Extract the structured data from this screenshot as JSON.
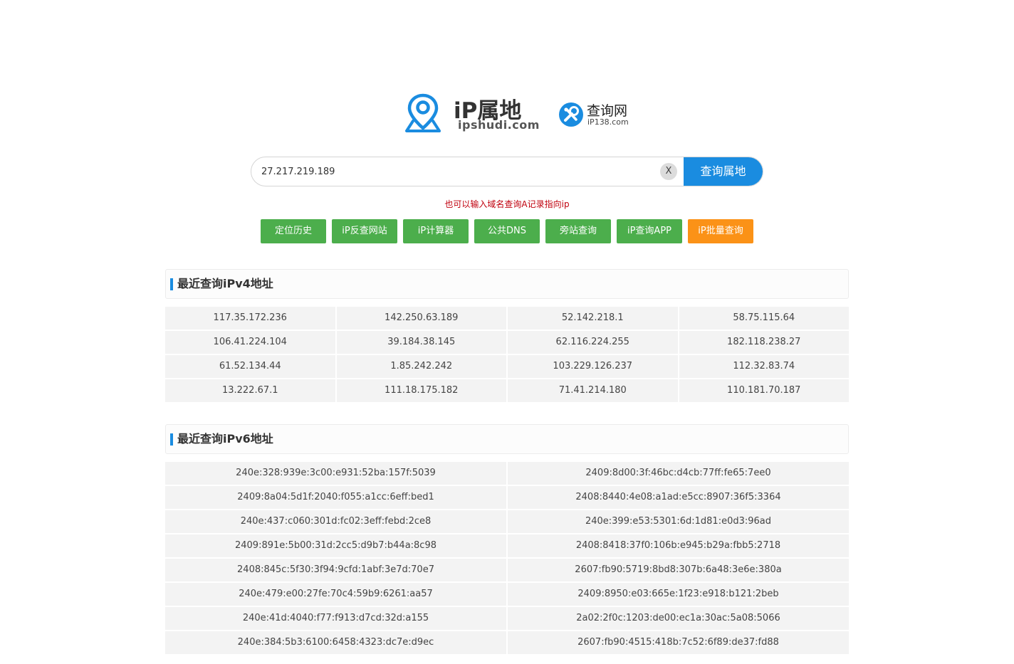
{
  "logo": {
    "title": "iP属地",
    "domain": "ipshudi.com"
  },
  "partner": {
    "name": "查询网",
    "domain": "iP138.com"
  },
  "icons": {
    "logo": "location-pin-icon",
    "partner": "wrench-icon",
    "clear": "close-icon"
  },
  "colors": {
    "primary": "#1a8ce0",
    "tool_green": "#4cae4c",
    "tool_orange": "#fb9217",
    "hint_red": "#c0000d"
  },
  "search": {
    "value": "27.217.219.189",
    "clear_label": "X",
    "button_label": "查询属地",
    "hint": "也可以输入域名查询A记录指向ip"
  },
  "tools": [
    {
      "label": "定位历史"
    },
    {
      "label": "iP反查网站"
    },
    {
      "label": "iP计算器"
    },
    {
      "label": "公共DNS"
    },
    {
      "label": "旁站查询"
    },
    {
      "label": "iP查询APP"
    },
    {
      "label": "iP批量查询"
    }
  ],
  "ipv4": {
    "title": "最近查询iPv4地址",
    "items": [
      "117.35.172.236",
      "142.250.63.189",
      "52.142.218.1",
      "58.75.115.64",
      "106.41.224.104",
      "39.184.38.145",
      "62.116.224.255",
      "182.118.238.27",
      "61.52.134.44",
      "1.85.242.242",
      "103.229.126.237",
      "112.32.83.74",
      "13.222.67.1",
      "111.18.175.182",
      "71.41.214.180",
      "110.181.70.187"
    ]
  },
  "ipv6": {
    "title": "最近查询iPv6地址",
    "items": [
      "240e:328:939e:3c00:e931:52ba:157f:5039",
      "2409:8d00:3f:46bc:d4cb:77ff:fe65:7ee0",
      "2409:8a04:5d1f:2040:f055:a1cc:6eff:bed1",
      "2408:8440:4e08:a1ad:e5cc:8907:36f5:3364",
      "240e:437:c060:301d:fc02:3eff:febd:2ce8",
      "240e:399:e53:5301:6d:1d81:e0d3:96ad",
      "2409:891e:5b00:31d:2cc5:d9b7:b44a:8c98",
      "2408:8418:37f0:106b:e945:b29a:fbb5:2718",
      "2408:845c:5f30:3f94:9cfd:1abf:3e7d:70e7",
      "2607:fb90:5719:8bd8:307b:6a48:3e6e:380a",
      "240e:479:e00:27fe:70c4:59b9:6261:aa57",
      "2409:8950:e03:665e:1f23:e918:b121:2beb",
      "240e:41d:4040:f77:f913:d7cd:32d:a155",
      "2a02:2f0c:1203:de00:ec1a:30ac:5a08:5066",
      "240e:384:5b3:6100:6458:4323:dc7e:d9ec",
      "2607:fb90:4515:418b:7c52:6f89:de37:fd88"
    ]
  }
}
